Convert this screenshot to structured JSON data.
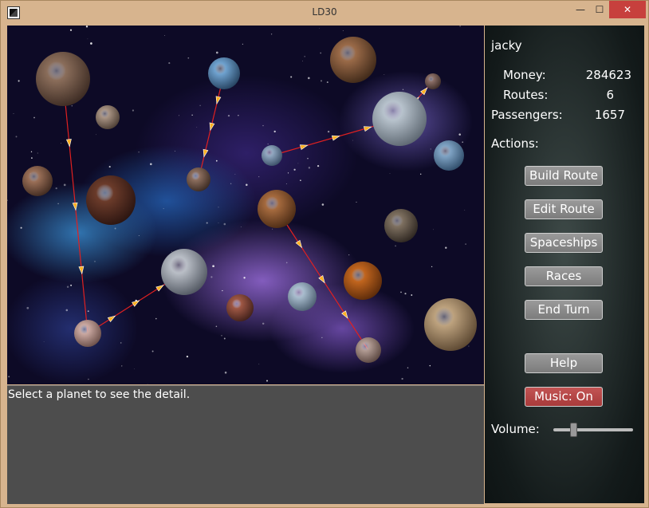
{
  "window": {
    "title": "LD30",
    "minimize_glyph": "—",
    "maximize_glyph": "☐",
    "close_glyph": "✕",
    "close_color": "#c7403d"
  },
  "map": {
    "planets": [
      {
        "name": "planet-1",
        "color": "#8a6d5a",
        "shade": "#3b2a22"
      },
      {
        "name": "planet-2",
        "color": "#6fa2cf",
        "shade": "#25415e"
      },
      {
        "name": "planet-3",
        "color": "#a89383",
        "shade": "#4b3d33"
      },
      {
        "name": "planet-4",
        "color": "#9a6f57",
        "shade": "#3f2a20"
      },
      {
        "name": "planet-5",
        "color": "#6b3b2a",
        "shade": "#2a1410"
      },
      {
        "name": "planet-6",
        "color": "#b7c2cc",
        "shade": "#5c6670"
      },
      {
        "name": "planet-7",
        "color": "#8a6e66",
        "shade": "#3d2c27"
      },
      {
        "name": "planet-8",
        "color": "#b9bec6",
        "shade": "#505660"
      },
      {
        "name": "planet-9",
        "color": "#8fa6bf",
        "shade": "#3a4e66"
      },
      {
        "name": "planet-10",
        "color": "#7fa3c4",
        "shade": "#2f4c69"
      },
      {
        "name": "planet-11",
        "color": "#8c6e5e",
        "shade": "#3a2a22"
      },
      {
        "name": "planet-12",
        "color": "#a56a3e",
        "shade": "#4a2a14"
      },
      {
        "name": "planet-13",
        "color": "#7e7060",
        "shade": "#2d2620"
      },
      {
        "name": "planet-14",
        "color": "#9e5744",
        "shade": "#40201a"
      },
      {
        "name": "planet-15",
        "color": "#a8bccd",
        "shade": "#4c5e70"
      },
      {
        "name": "planet-16",
        "color": "#c1651e",
        "shade": "#5a2a0a"
      },
      {
        "name": "planet-17",
        "color": "#9a6a48",
        "shade": "#3e2818"
      },
      {
        "name": "planet-18",
        "color": "#bda27e",
        "shade": "#5a4630"
      },
      {
        "name": "planet-19",
        "color": "#c9a7a0",
        "shade": "#6a4e48"
      },
      {
        "name": "planet-20",
        "color": "#b09a92",
        "shade": "#5a4640"
      }
    ],
    "route_color": "#e02020",
    "ship_color": "#ffb020"
  },
  "info": {
    "message": "Select a planet to see the detail."
  },
  "panel": {
    "player": "jacky",
    "stats": [
      {
        "label": "Money:",
        "value": "284623"
      },
      {
        "label": "Routes:",
        "value": "6"
      },
      {
        "label": "Passengers:",
        "value": "1657"
      }
    ],
    "actions_label": "Actions:",
    "buttons": {
      "build_route": "Build Route",
      "edit_route": "Edit Route",
      "spaceships": "Spaceships",
      "races": "Races",
      "end_turn": "End Turn",
      "help": "Help",
      "music": "Music: On"
    },
    "volume_label": "Volume:",
    "volume_level": 0.25
  }
}
